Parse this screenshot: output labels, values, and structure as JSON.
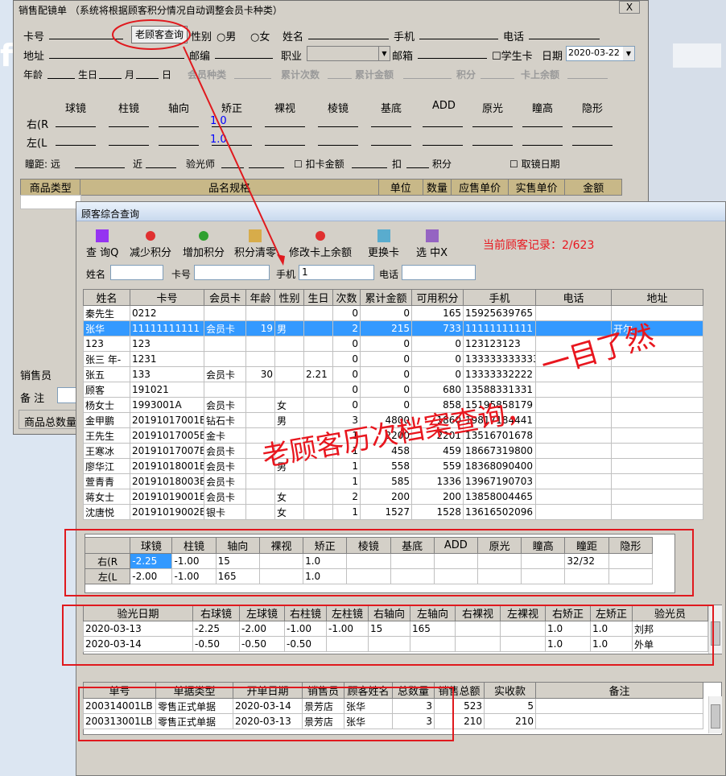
{
  "bg_window": {
    "title": "销售配镜单 （系统将根据顾客积分情况自动调整会员卡种类）",
    "close": "X",
    "old_customer_btn": "老顾客查询",
    "row1": {
      "card_no": "卡号",
      "gender": "性别",
      "male": "男",
      "female": "女",
      "name": "姓名",
      "mobile": "手机",
      "phone": "电话"
    },
    "row2": {
      "address": "地址",
      "postcode": "邮编",
      "job": "职业",
      "email": "邮箱",
      "student": "学生卡",
      "date_label": "日期",
      "date": "2020-03-22"
    },
    "row3": {
      "age": "年龄",
      "birth": "生日",
      "month": "月",
      "day": "日",
      "card_type": "会员种类",
      "visits": "累计次数",
      "total": "累计金额",
      "points": "积分",
      "balance": "卡上余额"
    },
    "rx_headers": [
      "球镜",
      "柱镜",
      "轴向",
      "矫正",
      "裸视",
      "棱镜",
      "基底",
      "ADD",
      "原光",
      "瞳高",
      "隐形"
    ],
    "rx_right": "右(R",
    "rx_left": "左(L",
    "rx_right_correct": "1.0",
    "rx_left_correct": "1.0",
    "row_pd": {
      "pd": "瞳距: 远",
      "near": "近",
      "optometrist": "验光师",
      "deduct_card": "扣卡金额",
      "deduct": "扣",
      "points": "积分",
      "pickup": "取镜日期"
    },
    "goods_headers": [
      "商品类型",
      "品名规格",
      "单位",
      "数量",
      "应售单价",
      "实售单价",
      "金额"
    ],
    "salesman": "销售员",
    "remark": "备 注",
    "total_qty": "商品总数量"
  },
  "dialog": {
    "title": "顾客综合查询",
    "toolbar": [
      {
        "label": "查 询Q",
        "icon": "query-icon"
      },
      {
        "label": "减少积分",
        "icon": "minus-icon"
      },
      {
        "label": "增加积分",
        "icon": "plus-icon"
      },
      {
        "label": "积分清零",
        "icon": "clear-icon"
      },
      {
        "label": "修改卡上余额",
        "icon": "edit-balance-icon"
      },
      {
        "label": "更换卡",
        "icon": "swap-card-icon"
      },
      {
        "label": "选 中X",
        "icon": "select-icon"
      }
    ],
    "record_info": "当前顾客记录：2/623",
    "search": {
      "name": "姓名",
      "card": "卡号",
      "mobile": "手机",
      "mobile_value": "1",
      "phone": "电话"
    },
    "customer_headers": [
      "姓名",
      "卡号",
      "会员卡",
      "年龄",
      "性别",
      "生日",
      "次数",
      "累计金额",
      "可用积分",
      "手机",
      "电话",
      "地址"
    ],
    "customers": [
      [
        "秦先生",
        "0212",
        "",
        "",
        "",
        "",
        "0",
        "0",
        "165",
        "15925639765",
        "",
        ""
      ],
      [
        "张华",
        "11111111111",
        "会员卡",
        "19",
        "男",
        "",
        "2",
        "215",
        "733",
        "11111111111",
        "",
        "开尔"
      ],
      [
        "123",
        "123",
        "",
        "",
        "",
        "",
        "0",
        "0",
        "0",
        "123123123",
        "",
        ""
      ],
      [
        "张三 年-",
        "1231",
        "",
        "",
        "",
        "",
        "0",
        "0",
        "0",
        "133333333333",
        "",
        ""
      ],
      [
        "张五",
        "133",
        "会员卡",
        "30",
        "",
        "2.21",
        "0",
        "0",
        "0",
        "13333332222",
        "",
        ""
      ],
      [
        "顾客",
        "191021",
        "",
        "",
        "",
        "",
        "0",
        "0",
        "680",
        "13588331331",
        "",
        ""
      ],
      [
        "杨女士",
        "1993001A",
        "会员卡",
        "",
        "女",
        "",
        "0",
        "0",
        "858",
        "15195858179",
        "",
        ""
      ],
      [
        "金甲鹏",
        "20191017001B",
        "钻石卡",
        "",
        "男",
        "",
        "3",
        "4800",
        "1860",
        "19817184441",
        "",
        ""
      ],
      [
        "王先生",
        "20191017005B",
        "金卡",
        "",
        "",
        "",
        "1",
        "2200",
        "2201",
        "13516701678",
        "",
        ""
      ],
      [
        "王寒冰",
        "20191017007B",
        "会员卡",
        "",
        "",
        "",
        "1",
        "458",
        "459",
        "18667319800",
        "",
        ""
      ],
      [
        "廖华江",
        "20191018001B",
        "会员卡",
        "",
        "男",
        "",
        "1",
        "558",
        "559",
        "18368090400",
        "",
        ""
      ],
      [
        "萱青青",
        "20191018003B",
        "会员卡",
        "",
        "",
        "",
        "1",
        "585",
        "1336",
        "13967190703",
        "",
        ""
      ],
      [
        "蒋女士",
        "20191019001B",
        "会员卡",
        "",
        "女",
        "",
        "2",
        "200",
        "200",
        "13858004465",
        "",
        ""
      ],
      [
        "沈唐悦",
        "20191019002B",
        "银卡",
        "",
        "女",
        "",
        "1",
        "1527",
        "1528",
        "13616502096",
        "",
        ""
      ]
    ],
    "rx_headers": [
      "球镜",
      "柱镜",
      "轴向",
      "裸视",
      "矫正",
      "棱镜",
      "基底",
      "ADD",
      "原光",
      "瞳高",
      "瞳距",
      "隐形"
    ],
    "rx_rows": [
      {
        "label": "右(R",
        "values": [
          "-2.25",
          "-1.00",
          "15",
          "",
          "1.0",
          "",
          "",
          "",
          "",
          "",
          "32/32",
          ""
        ]
      },
      {
        "label": "左(L",
        "values": [
          "-2.00",
          "-1.00",
          "165",
          "",
          "1.0",
          "",
          "",
          "",
          "",
          "",
          "",
          ""
        ]
      }
    ],
    "opt_headers": [
      "验光日期",
      "右球镜",
      "左球镜",
      "右柱镜",
      "左柱镜",
      "右轴向",
      "左轴向",
      "右裸视",
      "左裸视",
      "右矫正",
      "左矫正",
      "验光员"
    ],
    "opt_rows": [
      [
        "2020-03-13",
        "-2.25",
        "-2.00",
        "-1.00",
        "-1.00",
        "15",
        "165",
        "",
        "",
        "1.0",
        "1.0",
        "刘邦"
      ],
      [
        "2020-03-14",
        "-0.50",
        "-0.50",
        "-0.50",
        "",
        "",
        "",
        "",
        "",
        "1.0",
        "1.0",
        "外单"
      ]
    ],
    "order_headers": [
      "单号",
      "单据类型",
      "开单日期",
      "销售员",
      "顾客姓名",
      "总数量",
      "销售总额",
      "实收款",
      "备注"
    ],
    "order_rows": [
      [
        "200314001LB",
        "零售正式单据",
        "2020-03-14",
        "景芳店",
        "张华",
        "3",
        "523",
        "5",
        ""
      ],
      [
        "200313001LB",
        "零售正式单据",
        "2020-03-13",
        "景芳店",
        "张华",
        "3",
        "210",
        "210",
        ""
      ]
    ]
  },
  "annotations": {
    "main_caption": "老顾客历次档案查询，",
    "side_caption": "一目了然"
  },
  "colors": {
    "accent_red": "#e8161e",
    "selected_row": "#3399ff",
    "header_tan": "#c8b888",
    "blue_text": "#0000ff"
  }
}
